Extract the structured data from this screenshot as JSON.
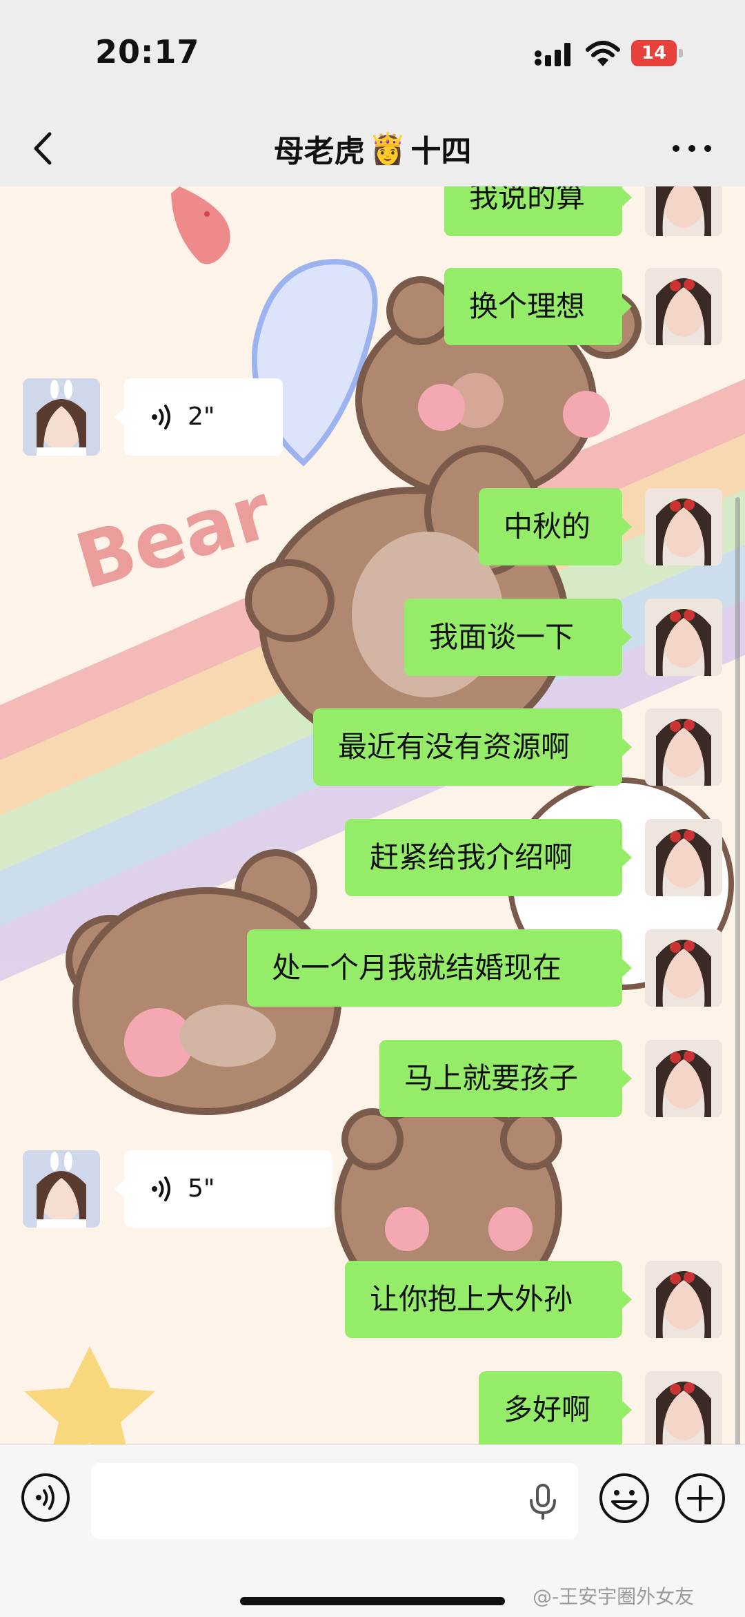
{
  "status_bar": {
    "time": "20:17",
    "battery": "14"
  },
  "header": {
    "title_prefix": "母老虎",
    "title_emoji": "👸",
    "title_suffix": "十四"
  },
  "messages": [
    {
      "type": "text",
      "side": "out",
      "text": "我说的算"
    },
    {
      "type": "text",
      "side": "out",
      "text": "换个理想"
    },
    {
      "type": "voice",
      "side": "in",
      "duration": "2\""
    },
    {
      "type": "text",
      "side": "out",
      "text": "中秋的"
    },
    {
      "type": "text",
      "side": "out",
      "text": "我面谈一下"
    },
    {
      "type": "text",
      "side": "out",
      "text": "最近有没有资源啊"
    },
    {
      "type": "text",
      "side": "out",
      "text": "赶紧给我介绍啊"
    },
    {
      "type": "text",
      "side": "out",
      "text": "处一个月我就结婚现在"
    },
    {
      "type": "text",
      "side": "out",
      "text": "马上就要孩子"
    },
    {
      "type": "voice",
      "side": "in",
      "duration": "5\""
    },
    {
      "type": "text",
      "side": "out",
      "text": "让你抱上大外孙"
    },
    {
      "type": "text",
      "side": "out",
      "text": "多好啊"
    }
  ],
  "wallpaper": {
    "label": "Bear"
  },
  "watermark": "@-王安宇圈外女友",
  "icons": {
    "back": "chevron-left-icon",
    "more": "more-dots-icon",
    "voice": "voice-wave-icon",
    "mic": "mic-icon",
    "emoji": "emoji-icon",
    "plus": "plus-icon"
  },
  "colors": {
    "outgoing_bubble": "#95ec69",
    "incoming_bubble": "#ffffff",
    "bar": "#ededed"
  }
}
